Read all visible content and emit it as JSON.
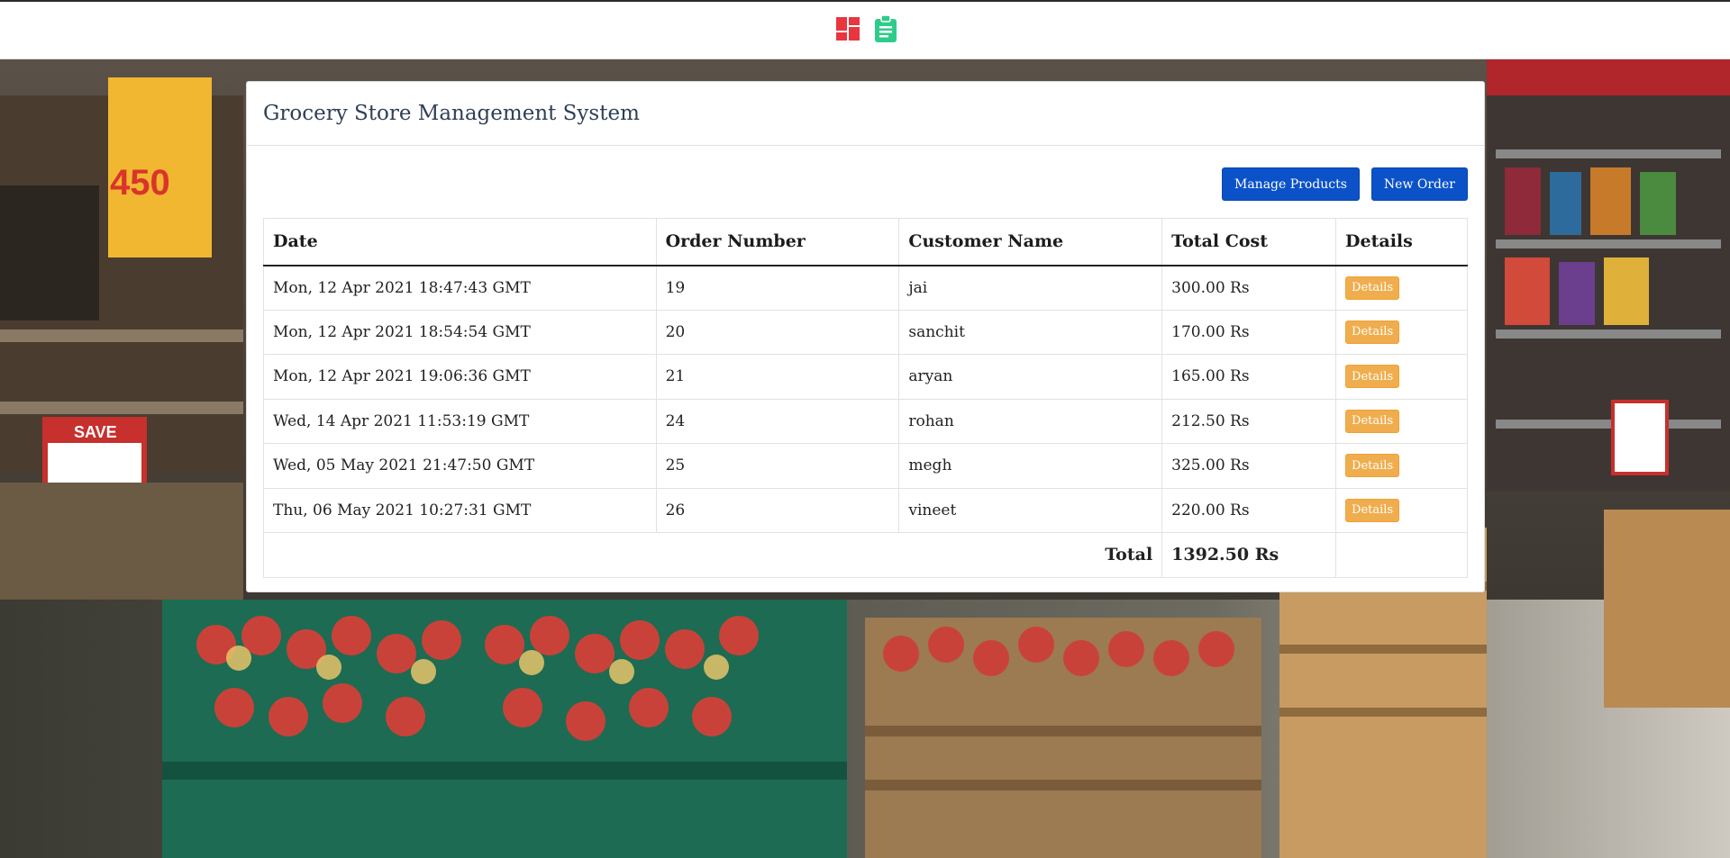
{
  "header": {
    "icons": [
      "dashboard-icon",
      "clipboard-icon"
    ],
    "colors": {
      "dashboard": "#e8363f",
      "clipboard": "#2ecc8a"
    }
  },
  "panel": {
    "title": "Grocery Store Management System"
  },
  "actions": {
    "manage_products": "Manage Products",
    "new_order": "New Order"
  },
  "table": {
    "headers": [
      "Date",
      "Order Number",
      "Customer Name",
      "Total Cost",
      "Details"
    ],
    "rows": [
      {
        "date": "Mon, 12 Apr 2021 18:47:43 GMT",
        "order": "19",
        "customer": "jai",
        "cost": "300.00 Rs",
        "details": "Details"
      },
      {
        "date": "Mon, 12 Apr 2021 18:54:54 GMT",
        "order": "20",
        "customer": "sanchit",
        "cost": "170.00 Rs",
        "details": "Details"
      },
      {
        "date": "Mon, 12 Apr 2021 19:06:36 GMT",
        "order": "21",
        "customer": "aryan",
        "cost": "165.00 Rs",
        "details": "Details"
      },
      {
        "date": "Wed, 14 Apr 2021 11:53:19 GMT",
        "order": "24",
        "customer": "rohan",
        "cost": "212.50 Rs",
        "details": "Details"
      },
      {
        "date": "Wed, 05 May 2021 21:47:50 GMT",
        "order": "25",
        "customer": "megh",
        "cost": "325.00 Rs",
        "details": "Details"
      },
      {
        "date": "Thu, 06 May 2021 10:27:31 GMT",
        "order": "26",
        "customer": "vineet",
        "cost": "220.00 Rs",
        "details": "Details"
      }
    ],
    "total_label": "Total",
    "total_value": "1392.50 Rs"
  },
  "colors": {
    "primary_button": "#0b52c9",
    "details_button": "#f0ad4e",
    "title_text": "#2f3f55"
  }
}
